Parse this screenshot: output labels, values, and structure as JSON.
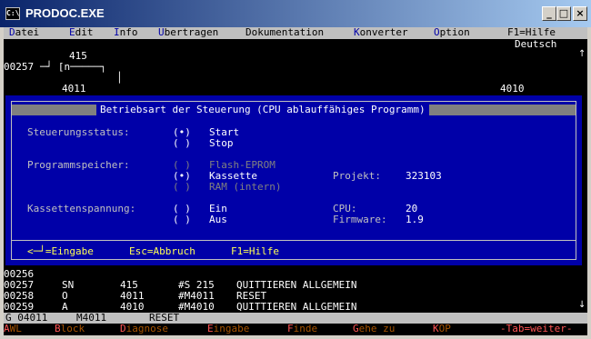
{
  "window": {
    "title": "PRODOC.EXE",
    "icon_text": "C:\\"
  },
  "menu": {
    "items": [
      {
        "hk": "D",
        "rest": "atei"
      },
      {
        "hk": "E",
        "rest": "dit"
      },
      {
        "hk": "I",
        "rest": "nfo"
      },
      {
        "hk": "Ü",
        "rest": "bertragen"
      },
      {
        "hk": "",
        "rest": "Dokumentation"
      },
      {
        "hk": "K",
        "rest": "onverter"
      },
      {
        "hk": "O",
        "rest": "ption"
      },
      {
        "hk": "F1",
        "rest": "=Hilfe"
      }
    ],
    "language": "Deutsch"
  },
  "ladder": {
    "addr_top": "415",
    "row_label": "00257",
    "contact": "─┘ [n─────┐",
    "addr_bottom_left": "4011",
    "addr_bottom_right": "4010"
  },
  "dialog": {
    "title": "Betriebsart der Steuerung (CPU ablauffähiges Programm)",
    "status_label": "Steuerungsstatus:",
    "status_options": [
      {
        "radio": "(•)",
        "label": "Start"
      },
      {
        "radio": "( )",
        "label": "Stop"
      }
    ],
    "memory_label": "Programmspeicher:",
    "memory_options": [
      {
        "radio": "( )",
        "label": "Flash-EPROM"
      },
      {
        "radio": "(•)",
        "label": "Kassette"
      },
      {
        "radio": "( )",
        "label": "RAM (intern)"
      }
    ],
    "project_label": "Projekt:",
    "project_value": "323103",
    "voltage_label": "Kassettenspannung:",
    "voltage_options": [
      {
        "radio": "( )",
        "label": "Ein"
      },
      {
        "radio": "( )",
        "label": "Aus"
      }
    ],
    "cpu_label": "CPU:",
    "cpu_value": "20",
    "firmware_label": "Firmware:",
    "firmware_value": "1.9",
    "footer": {
      "enter": "<─┘=Eingabe",
      "esc": "Esc=Abbruch",
      "help": "F1=Hilfe"
    }
  },
  "listing": [
    {
      "nr": "00256",
      "op": "",
      "arg": "",
      "sym": "",
      "comment": ""
    },
    {
      "nr": "00257",
      "op": "SN",
      "arg": "415",
      "sym": "#S 215",
      "comment": "QUITTIEREN ALLGEMEIN"
    },
    {
      "nr": "00258",
      "op": "O",
      "arg": "4011",
      "sym": "#M4011",
      "comment": "RESET"
    },
    {
      "nr": "00259",
      "op": "A",
      "arg": "4010",
      "sym": "#M4010",
      "comment": "QUITTIEREN ALLGEMEIN"
    }
  ],
  "status": {
    "g": "G 04011",
    "m": "M4011",
    "text": "RESET"
  },
  "fkeys": [
    {
      "hk": "A",
      "rest": "WL"
    },
    {
      "hk": "B",
      "rest": "lock"
    },
    {
      "hk": "D",
      "rest": "iagnose"
    },
    {
      "hk": "E",
      "rest": "ingabe"
    },
    {
      "hk": "F",
      "rest": "inde"
    },
    {
      "hk": "G",
      "rest": "ehe zu"
    },
    {
      "hk": "K",
      "rest": "OP"
    },
    {
      "hk": "",
      "rest": "-Tab=weiter-"
    }
  ]
}
